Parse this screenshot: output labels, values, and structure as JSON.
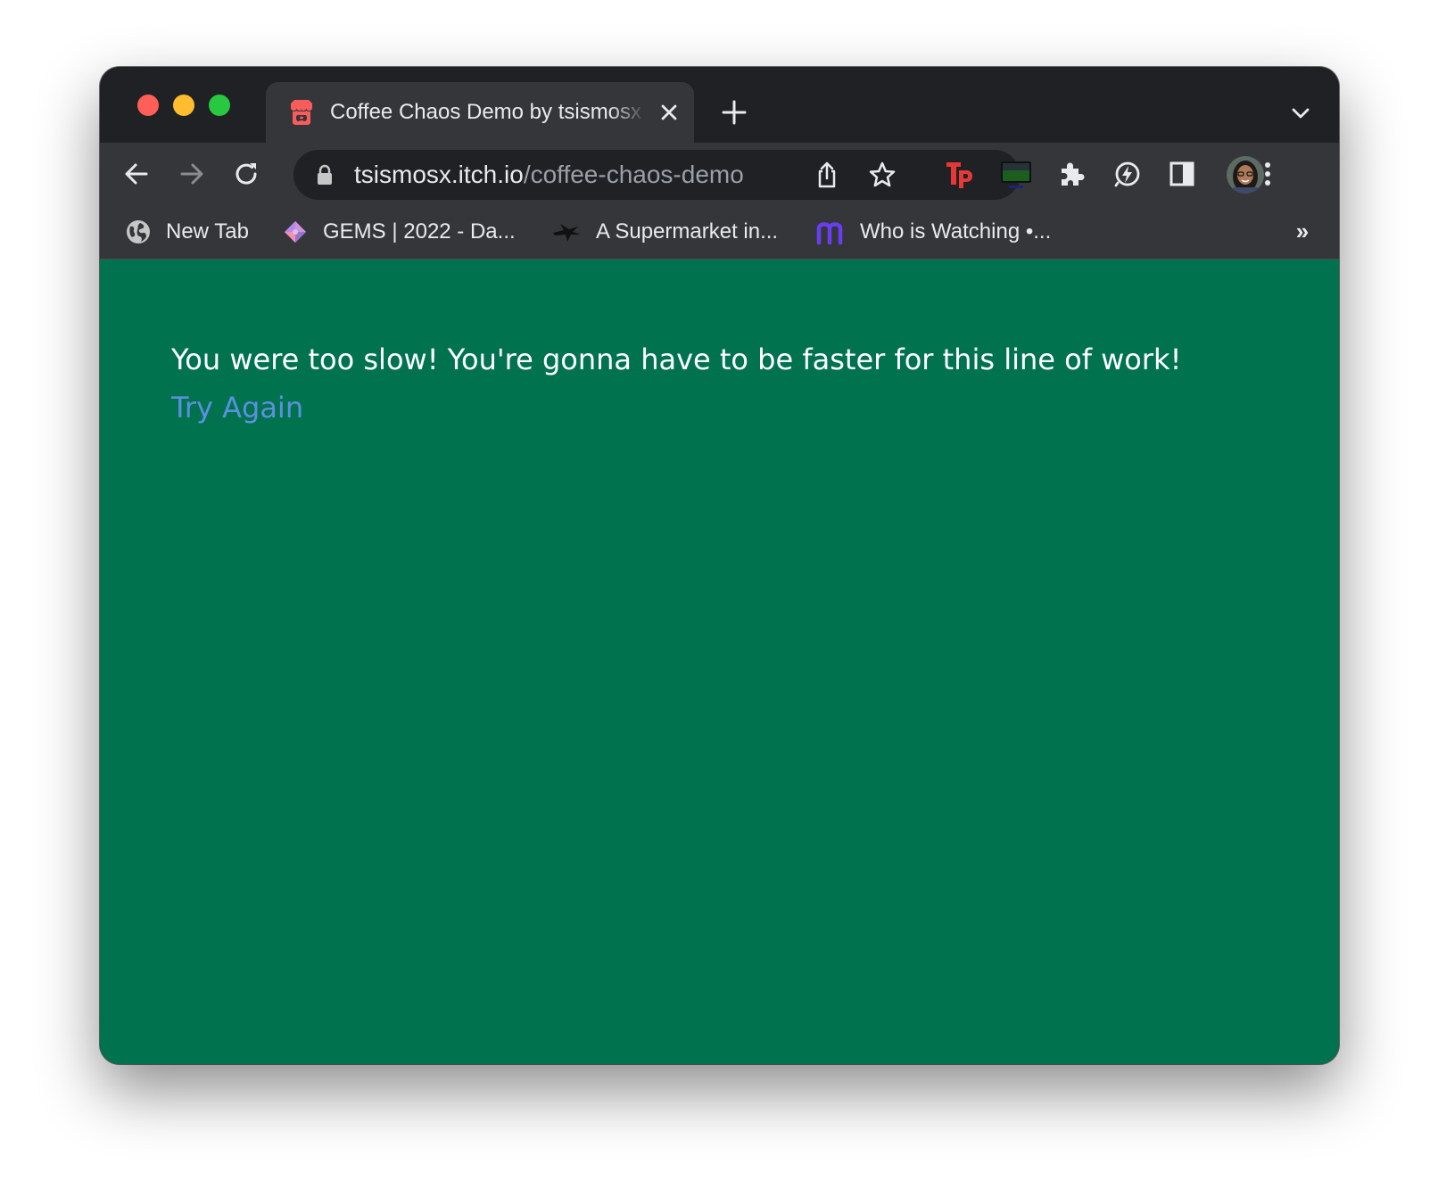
{
  "browser": {
    "tab": {
      "title": "Coffee Chaos Demo by tsismosx",
      "favicon": "itch-io-icon"
    },
    "address": {
      "host": "tsismosx.itch.io",
      "path": "/coffee-chaos-demo"
    },
    "bookmarks": [
      {
        "label": "New Tab",
        "icon": "globe-icon"
      },
      {
        "label": "GEMS | 2022 - Da...",
        "icon": "gem-icon"
      },
      {
        "label": "A Supermarket in...",
        "icon": "bird-icon"
      },
      {
        "label": "Who is Watching •...",
        "icon": "m-logo-icon"
      }
    ],
    "bookmarks_overflow": "»",
    "extensions": [
      "tp-extension-icon",
      "monitor-extension-icon",
      "puzzle-icon",
      "bolt-extension-icon",
      "side-panel-icon",
      "avatar",
      "kebab-menu-icon"
    ]
  },
  "page": {
    "message": "You were too slow! You're gonna have to be faster for this line of work!",
    "link": "Try Again",
    "background": "#00734e",
    "link_color": "#5b8fe0"
  }
}
